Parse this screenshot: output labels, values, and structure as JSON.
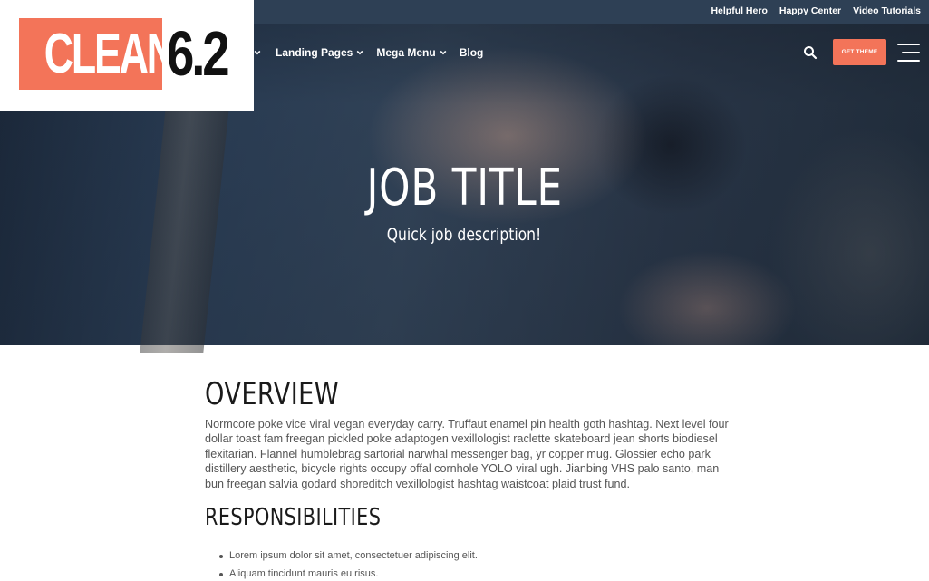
{
  "topbar": {
    "links": [
      "Helpful Hero",
      "Happy Center",
      "Video Tutorials"
    ]
  },
  "logo": {
    "word": "CLEAN",
    "version": "6.2"
  },
  "nav": {
    "items": [
      {
        "label": "Landing Pages",
        "has_dropdown": true
      },
      {
        "label": "Mega Menu",
        "has_dropdown": true
      },
      {
        "label": "Blog",
        "has_dropdown": false
      }
    ],
    "cta_label": "GET THEME"
  },
  "hero": {
    "title": "JOB TITLE",
    "subtitle": "Quick job description!"
  },
  "overview": {
    "heading": "OVERVIEW",
    "text": "Normcore poke vice viral vegan everyday carry. Truffaut enamel pin health goth hashtag. Next level four dollar toast fam freegan pickled poke adaptogen vexillologist raclette skateboard jean shorts biodiesel flexitarian. Flannel humblebrag sartorial narwhal messenger bag, yr copper mug. Glossier echo park distillery aesthetic, bicycle rights occupy offal cornhole YOLO viral ugh. Jianbing VHS palo santo, man bun freegan salvia godard shoreditch vexillologist hashtag waistcoat plaid trust fund."
  },
  "responsibilities": {
    "heading": "RESPONSIBILITIES",
    "items": [
      "Lorem ipsum dolor sit amet, consectetuer adipiscing elit.",
      "Aliquam tincidunt mauris eu risus."
    ]
  },
  "colors": {
    "accent": "#f37459",
    "topbar": "#2e4055",
    "text": "#555555",
    "heading": "#1a1a1a"
  },
  "icons": {
    "search": "search-icon",
    "menu": "hamburger-menu-icon",
    "dropdown": "chevron-down-icon"
  }
}
